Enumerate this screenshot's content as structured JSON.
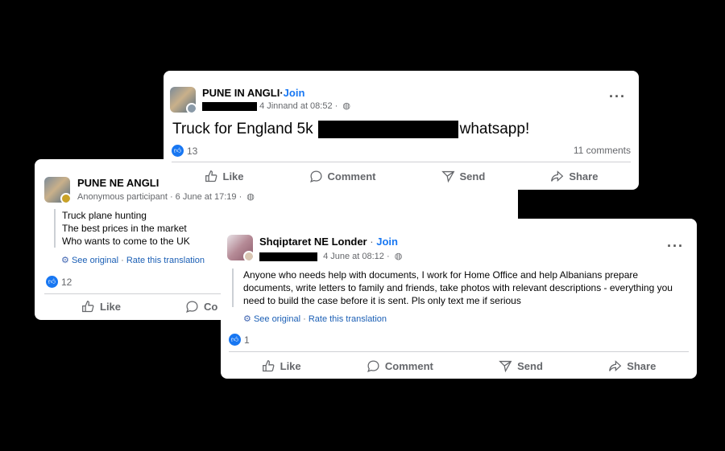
{
  "post_left": {
    "group_name": "PUNE NE ANGLI",
    "author_meta": "Anonymous participant · 6 June at 17:19 ·",
    "body_lines": [
      "Truck plane hunting",
      "The best prices in the market",
      "Who wants to come to the UK"
    ],
    "see_original": "See original",
    "rate_translation": "Rate this translation",
    "separator": "·",
    "reactions": "12",
    "like_label": "Like",
    "comment_label_partial": "Co"
  },
  "post_top": {
    "group_name": "PUNE IN ANGLI",
    "separator": "·",
    "join_label": "Join",
    "date_meta": "4 Jinnand at 08:52 ·",
    "body_start": "Truck for England 5k",
    "body_end": "whatsapp!",
    "reactions": "13",
    "comments": "11 comments",
    "like_label": "Like",
    "comment_label": "Comment",
    "send_label": "Send",
    "share_label": "Share"
  },
  "post_right": {
    "group_name": "Shqiptaret NE Londer",
    "separator": "·",
    "join_label": "Join",
    "date_meta": "4 June at 08:12 ·",
    "body": "Anyone who needs help with documents, I work for Home Office and help Albanians prepare documents, write letters to family and friends, take photos with relevant descriptions - everything you need to build the case before it is sent. Pls only text me if serious",
    "see_original": "See original",
    "rate_translation": "Rate this translation",
    "reactions": "1",
    "like_label": "Like",
    "comment_label": "Comment",
    "send_label": "Send",
    "share_label": "Share"
  },
  "icons": [
    "thumbs-up-icon",
    "comment-icon",
    "send-icon",
    "share-icon",
    "globe-icon",
    "translate-gear-icon",
    "more-options-icon"
  ]
}
